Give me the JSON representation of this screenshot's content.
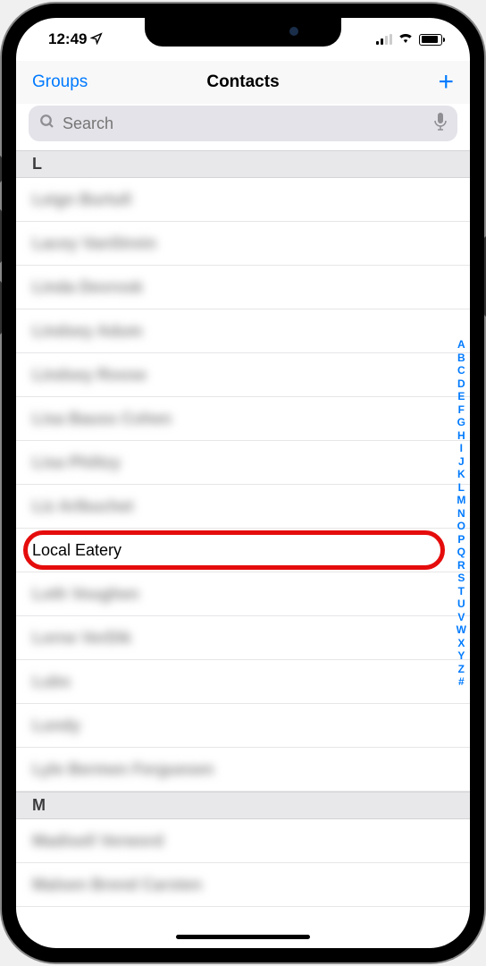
{
  "status_bar": {
    "time": "12:49"
  },
  "nav": {
    "groups_label": "Groups",
    "title": "Contacts",
    "add_label": "+"
  },
  "search": {
    "placeholder": "Search"
  },
  "sections": [
    {
      "letter": "L",
      "contacts": [
        {
          "name": "Leign Burtull",
          "blurred": true
        },
        {
          "name": "Lacey VanStrein",
          "blurred": true
        },
        {
          "name": "Linda Devrosk",
          "blurred": true
        },
        {
          "name": "Lindsey Adum",
          "blurred": true
        },
        {
          "name": "Lindsey Roose",
          "blurred": true
        },
        {
          "name": "Lisa Bauss Cohen",
          "blurred": true
        },
        {
          "name": "Lisa Philtzy",
          "blurred": true
        },
        {
          "name": "Liz Arlbuchet",
          "blurred": true
        },
        {
          "name": "Local Eatery",
          "blurred": false,
          "highlighted": true
        },
        {
          "name": "Loth Voughen",
          "blurred": true
        },
        {
          "name": "Lorne VerDik",
          "blurred": true
        },
        {
          "name": "Lubs",
          "blurred": true
        },
        {
          "name": "Lundy",
          "blurred": true
        },
        {
          "name": "Lyle Bermen Ferguesen",
          "blurred": true
        }
      ]
    },
    {
      "letter": "M",
      "contacts": [
        {
          "name": "Madisell Verword",
          "blurred": true
        },
        {
          "name": "Malsen Brend Carsten",
          "blurred": true
        }
      ]
    }
  ],
  "index_letters": [
    "A",
    "B",
    "C",
    "D",
    "E",
    "F",
    "G",
    "H",
    "I",
    "J",
    "K",
    "L",
    "M",
    "N",
    "O",
    "P",
    "Q",
    "R",
    "S",
    "T",
    "U",
    "V",
    "W",
    "X",
    "Y",
    "Z",
    "#"
  ]
}
